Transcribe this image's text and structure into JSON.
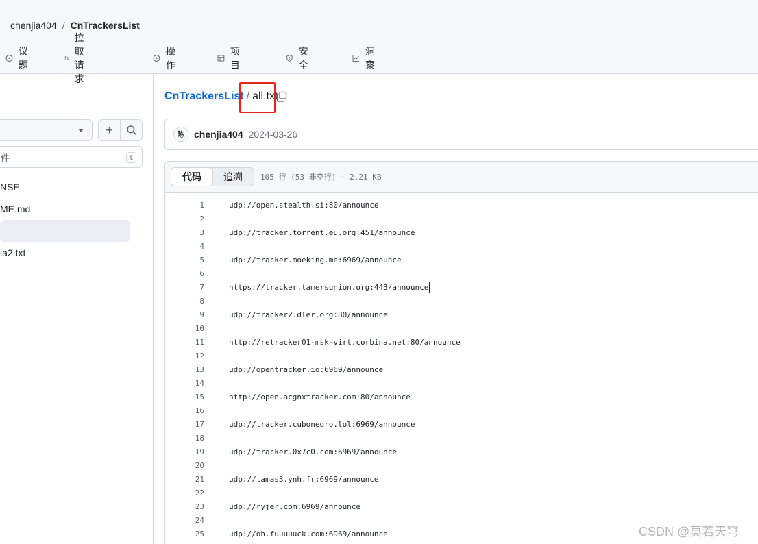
{
  "header": {
    "owner": "chenjia404",
    "separator": "/",
    "repo": "CnTrackersList"
  },
  "nav": [
    {
      "label": "议题",
      "icon": "issue-icon"
    },
    {
      "label": "拉取请求",
      "icon": "pull-request-icon"
    },
    {
      "label": "操作",
      "icon": "play-icon"
    },
    {
      "label": "项目",
      "icon": "table-icon"
    },
    {
      "label": "安全",
      "icon": "shield-icon"
    },
    {
      "label": "洞察",
      "icon": "graph-icon"
    }
  ],
  "sidebar": {
    "file_search_placeholder": "件",
    "shortcut_key": "t",
    "tree": [
      "NSE",
      "ME.md",
      "",
      "ia2.txt"
    ]
  },
  "breadcrumb": {
    "repo": "CnTrackersList",
    "slash": "/",
    "file": "all.txt"
  },
  "commit": {
    "avatar_text": "陈",
    "author": "chenjia404",
    "date": "2024-03-26"
  },
  "code": {
    "tab_code": "代码",
    "tab_blame": "追溯",
    "meta": "105 行 (53 非空行) · 2.21 KB",
    "lines": [
      {
        "n": "1",
        "text": "udp://open.stealth.si:80/announce"
      },
      {
        "n": "2",
        "text": ""
      },
      {
        "n": "3",
        "text": "udp://tracker.torrent.eu.org:451/announce"
      },
      {
        "n": "4",
        "text": ""
      },
      {
        "n": "5",
        "text": "udp://tracker.moeking.me:6969/announce"
      },
      {
        "n": "6",
        "text": ""
      },
      {
        "n": "7",
        "text": "https://tracker.tamersunion.org:443/announce"
      },
      {
        "n": "8",
        "text": ""
      },
      {
        "n": "9",
        "text": "udp://tracker2.dler.org:80/announce"
      },
      {
        "n": "10",
        "text": ""
      },
      {
        "n": "11",
        "text": "http://retracker01-msk-virt.corbina.net:80/announce"
      },
      {
        "n": "12",
        "text": ""
      },
      {
        "n": "13",
        "text": "udp://opentracker.io:6969/announce"
      },
      {
        "n": "14",
        "text": ""
      },
      {
        "n": "15",
        "text": "http://open.acgnxtracker.com:80/announce"
      },
      {
        "n": "16",
        "text": ""
      },
      {
        "n": "17",
        "text": "udp://tracker.cubonegro.lol:6969/announce"
      },
      {
        "n": "18",
        "text": ""
      },
      {
        "n": "19",
        "text": "udp://tracker.0x7c0.com:6969/announce"
      },
      {
        "n": "20",
        "text": ""
      },
      {
        "n": "21",
        "text": "udp://tamas3.ynh.fr:6969/announce"
      },
      {
        "n": "22",
        "text": ""
      },
      {
        "n": "23",
        "text": "udp://ryjer.com:6969/announce"
      },
      {
        "n": "24",
        "text": ""
      },
      {
        "n": "25",
        "text": "udp://oh.fuuuuuck.com:6969/announce"
      }
    ]
  },
  "watermark": "CSDN @莫若天穹"
}
